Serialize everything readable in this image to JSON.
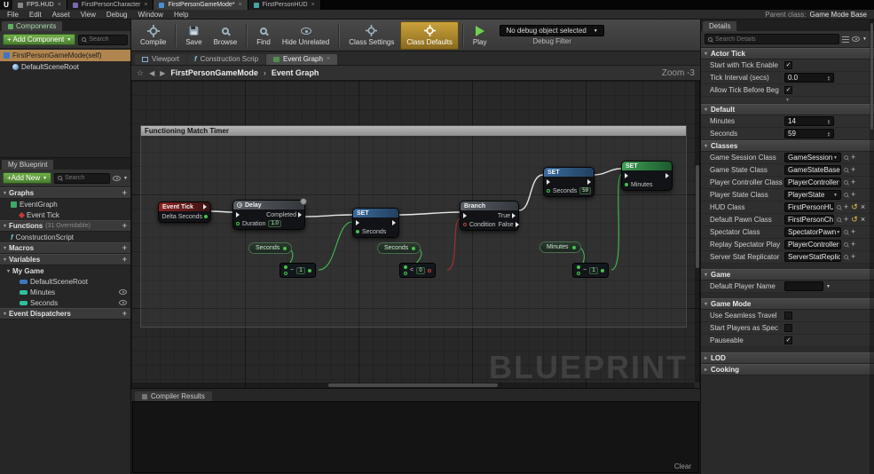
{
  "colors": {
    "class_defaults_highlight": "#b08a2e",
    "add_button_green": "#5a9e3d",
    "selected_row_tan": "#b0854f",
    "exec_wire": "#e6e6e6",
    "data_wire_green": "#3fbf4f",
    "bool_wire_red": "#a03030",
    "modified_indicator_yellow": "#e8c545"
  },
  "titlebar": {
    "app_tab": "FPS.HUD",
    "doc_tabs": [
      {
        "label": "FirstPersonCharacter"
      },
      {
        "label": "FirstPersonGameMode*"
      },
      {
        "label": "FirstPersonHUD"
      }
    ]
  },
  "menubar": {
    "items": [
      "File",
      "Edit",
      "Asset",
      "View",
      "Debug",
      "Window",
      "Help"
    ],
    "parent_class_label": "Parent class:",
    "parent_class_value": "Game Mode Base"
  },
  "components_panel": {
    "tab_label": "Components",
    "add_button_label": "+ Add Component",
    "search_placeholder": "Search",
    "rows": [
      {
        "label": "FirstPersonGameMode(self)"
      },
      {
        "label": "DefaultSceneRoot"
      }
    ]
  },
  "my_blueprint": {
    "tab_label": "My Blueprint",
    "add_button_label": "+Add New",
    "search_placeholder": "Search",
    "graphs_header": "Graphs",
    "graphs_items": [
      {
        "label": "EventGraph"
      },
      {
        "label": "Event Tick"
      }
    ],
    "functions_header": "Functions",
    "functions_suffix": "(31 Overridable)",
    "functions_items": [
      {
        "label": "ConstructionScript"
      }
    ],
    "macros_header": "Macros",
    "variables_header": "Variables",
    "variables_group": "My Game",
    "variables_items": [
      {
        "label": "DefaultSceneRoot"
      },
      {
        "label": "Minutes"
      },
      {
        "label": "Seconds"
      }
    ],
    "event_dispatchers_header": "Event Dispatchers"
  },
  "toolbar": {
    "compile": "Compile",
    "save": "Save",
    "browse": "Browse",
    "find": "Find",
    "hide_unrelated": "Hide Unrelated",
    "class_settings": "Class Settings",
    "class_defaults": "Class Defaults",
    "play": "Play",
    "debug_select_value": "No debug object selected",
    "debug_filter_label": "Debug Filter"
  },
  "graph": {
    "tabs": [
      {
        "label": "Viewport"
      },
      {
        "label": "Construction Scrip"
      },
      {
        "label": "Event Graph"
      }
    ],
    "breadcrumb_root": "FirstPersonGameMode",
    "breadcrumb_current": "Event Graph",
    "zoom_label": "Zoom -3",
    "comment_title": "Functioning Match Timer",
    "watermark": "BLUEPRINT",
    "nodes": {
      "event_tick": {
        "title": "Event Tick",
        "pin_delta": "Delta Seconds"
      },
      "delay": {
        "title": "Delay",
        "pin_completed": "Completed",
        "duration_label": "Duration",
        "duration_value": "1.0"
      },
      "set_seconds": {
        "title": "SET",
        "pin": "Seconds"
      },
      "branch": {
        "title": "Branch",
        "pin_condition": "Condition",
        "pin_true": "True",
        "pin_false": "False"
      },
      "set_seconds_reset": {
        "title": "SET",
        "pin": "Seconds",
        "value": "59"
      },
      "set_minutes": {
        "title": "SET",
        "pin": "Minutes"
      },
      "get_seconds_1": {
        "label": "Seconds"
      },
      "get_seconds_2": {
        "label": "Seconds"
      },
      "get_minutes": {
        "label": "Minutes"
      },
      "subtract_1": {
        "op": "−",
        "operand": "1"
      },
      "compare": {
        "op": "<",
        "operand": "0"
      },
      "subtract_2": {
        "op": "−",
        "operand": "1"
      }
    }
  },
  "compiler": {
    "tab_label": "Compiler Results",
    "clear_label": "Clear"
  },
  "details": {
    "tab_label": "Details",
    "search_placeholder": "Search Details",
    "sections": {
      "actor_tick": {
        "title": "Actor Tick",
        "rows": [
          {
            "name": "Start with Tick Enable",
            "check": "✓"
          },
          {
            "name": "Tick Interval (secs)",
            "value": "0.0"
          },
          {
            "name": "Allow Tick Before Beg",
            "check": "✓"
          }
        ]
      },
      "default": {
        "title": "Default",
        "rows": [
          {
            "name": "Minutes",
            "value": "14"
          },
          {
            "name": "Seconds",
            "value": "59"
          }
        ]
      },
      "classes": {
        "title": "Classes",
        "rows": [
          {
            "name": "Game Session Class",
            "value": "GameSession"
          },
          {
            "name": "Game State Class",
            "value": "GameStateBase"
          },
          {
            "name": "Player Controller Class",
            "value": "PlayerController"
          },
          {
            "name": "Player State Class",
            "value": "PlayerState"
          },
          {
            "name": "HUD Class",
            "value": "FirstPersonHUD"
          },
          {
            "name": "Default Pawn Class",
            "value": "FirstPersonCharac"
          },
          {
            "name": "Spectator Class",
            "value": "SpectatorPawn"
          },
          {
            "name": "Replay Spectator Play",
            "value": "PlayerController"
          },
          {
            "name": "Server Stat Replicator",
            "value": "ServerStatReplicator"
          }
        ]
      },
      "game": {
        "title": "Game",
        "rows": [
          {
            "name": "Default Player Name",
            "value": ""
          }
        ]
      },
      "game_mode": {
        "title": "Game Mode",
        "rows": [
          {
            "name": "Use Seamless Travel",
            "check": ""
          },
          {
            "name": "Start Players as Spec",
            "check": ""
          },
          {
            "name": "Pauseable",
            "check": "✓"
          }
        ]
      },
      "lod": {
        "title": "LOD"
      },
      "cooking": {
        "title": "Cooking"
      }
    }
  }
}
